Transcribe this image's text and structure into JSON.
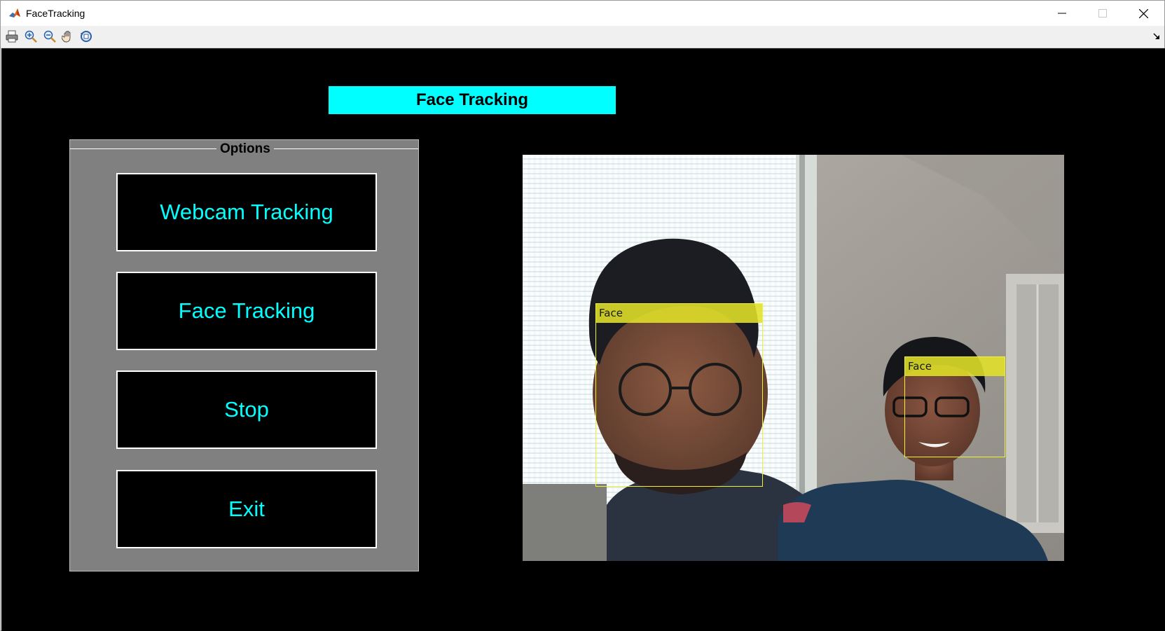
{
  "window": {
    "title": "FaceTracking",
    "controls": [
      "minimize",
      "maximize",
      "close"
    ]
  },
  "toolbar": {
    "tools": [
      {
        "icon": "print-icon"
      },
      {
        "icon": "zoom-in-icon"
      },
      {
        "icon": "zoom-out-icon"
      },
      {
        "icon": "pan-hand-icon"
      },
      {
        "icon": "rotate-3d-icon"
      }
    ]
  },
  "header": {
    "title": "Face Tracking",
    "background": "#00ffff"
  },
  "options": {
    "title": "Options",
    "buttons": [
      {
        "label": "Webcam Tracking"
      },
      {
        "label": "Face Tracking"
      },
      {
        "label": "Stop"
      },
      {
        "label": "Exit"
      }
    ],
    "button_text_color": "#00ffff"
  },
  "video": {
    "detections": [
      {
        "label": "Face"
      },
      {
        "label": "Face"
      }
    ],
    "box_color": "#f2f230"
  }
}
